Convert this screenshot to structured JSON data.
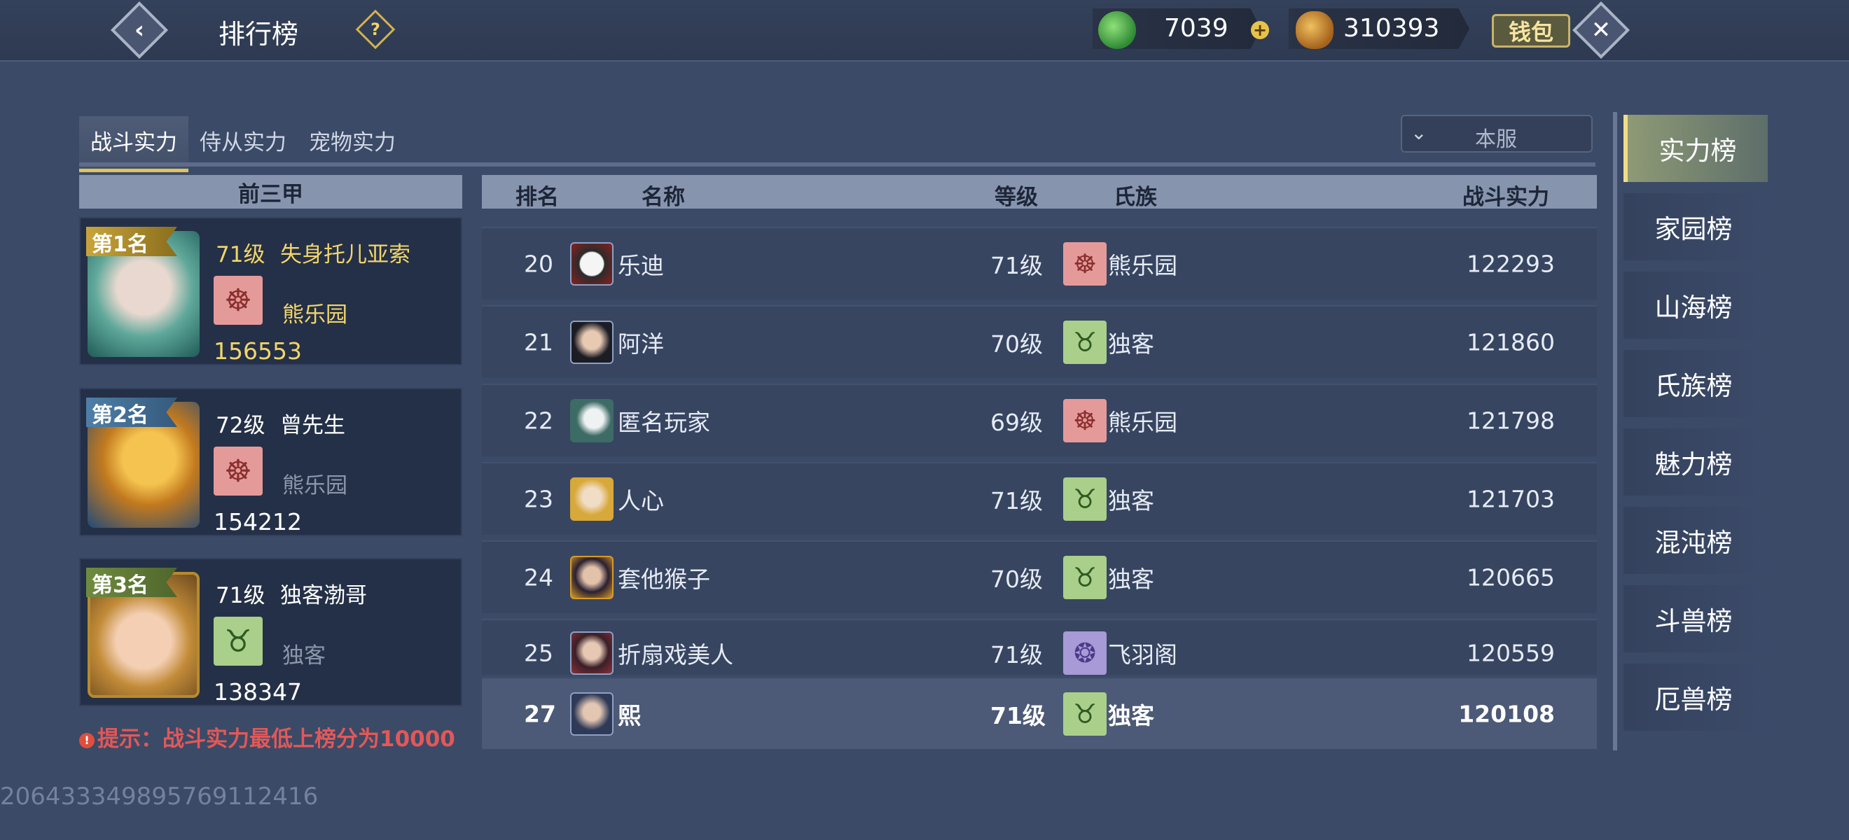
{
  "header": {
    "title": "排行榜",
    "help_icon": "question-icon",
    "jade_value": "7039",
    "coin_value": "310393",
    "wallet_label": "钱包"
  },
  "tabs": [
    {
      "label": "战斗实力",
      "active": true
    },
    {
      "label": "侍从实力",
      "active": false
    },
    {
      "label": "宠物实力",
      "active": false
    }
  ],
  "server_select": {
    "value": "本服"
  },
  "top3": {
    "header": "前三甲",
    "cards": [
      {
        "rank": "第1名",
        "level": "71级",
        "name": "失身托儿亚索",
        "clan": "熊乐园",
        "power": "156553"
      },
      {
        "rank": "第2名",
        "level": "72级",
        "name": "曾先生",
        "clan": "熊乐园",
        "power": "154212"
      },
      {
        "rank": "第3名",
        "level": "71级",
        "name": "独客渤哥",
        "clan": "独客",
        "power": "138347"
      }
    ],
    "tip": "提示：战斗实力最低上榜分为10000"
  },
  "table": {
    "columns": {
      "rank": "排名",
      "name": "名称",
      "level": "等级",
      "clan": "氏族",
      "power": "战斗实力"
    },
    "rows": [
      {
        "rank": "20",
        "name": "乐迪",
        "level": "71级",
        "clan": "熊乐园",
        "power": "122293"
      },
      {
        "rank": "21",
        "name": "阿洋",
        "level": "70级",
        "clan": "独客",
        "power": "121860"
      },
      {
        "rank": "22",
        "name": "匿名玩家",
        "level": "69级",
        "clan": "熊乐园",
        "power": "121798"
      },
      {
        "rank": "23",
        "name": "人心",
        "level": "71级",
        "clan": "独客",
        "power": "121703"
      },
      {
        "rank": "24",
        "name": "套他猴子",
        "level": "70级",
        "clan": "独客",
        "power": "120665"
      },
      {
        "rank": "25",
        "name": "折扇戏美人",
        "level": "71级",
        "clan": "飞羽阁",
        "power": "120559"
      }
    ],
    "self_row": {
      "rank": "27",
      "name": "熙",
      "level": "71级",
      "clan": "独客",
      "power": "120108"
    }
  },
  "side_tabs": [
    "实力榜",
    "家园榜",
    "山海榜",
    "氏族榜",
    "魅力榜",
    "混沌榜",
    "斗兽榜",
    "厄兽榜"
  ],
  "footer": {
    "id_text": "2064333498957691124​16"
  },
  "colors": {
    "gold": "#e2c35a",
    "tip_red": "#e25858",
    "clan_bear": "#e59a9a",
    "clan_solo": "#a9cf8a",
    "clan_feather": "#a79ad6"
  }
}
